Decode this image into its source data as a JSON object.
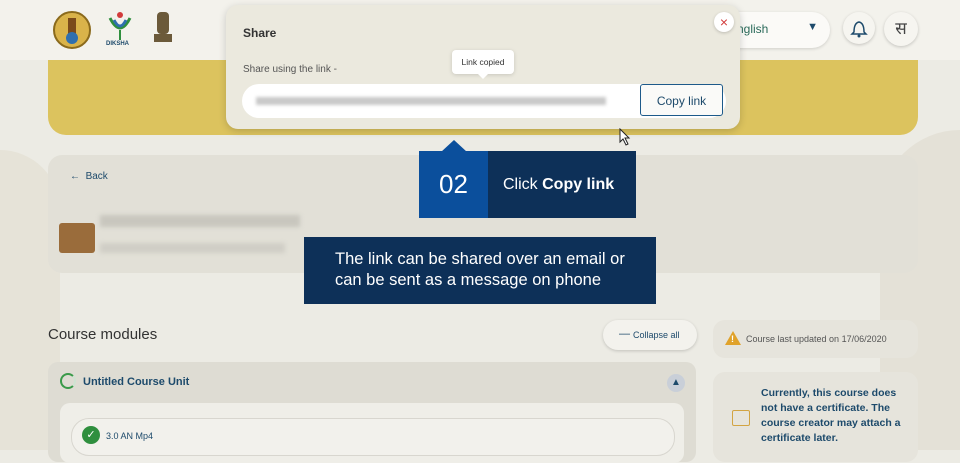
{
  "header": {
    "logo_caption": "DIKSHA",
    "language_selected": "nglish",
    "avatar_initial": "स"
  },
  "share_modal": {
    "title": "Share",
    "share_label": "Share using the link -",
    "copy_button": "Copy link",
    "tooltip": "Link copied",
    "close_symbol": "×"
  },
  "course": {
    "back_label": "Back"
  },
  "modules": {
    "heading": "Course modules",
    "collapse_label": "Collapse all",
    "unit_title": "Untitled Course Unit",
    "items": [
      {
        "label": "3.0 AN Mp4"
      }
    ]
  },
  "sidebar": {
    "last_updated": "Course last updated on 17/06/2020",
    "certificate_note": "Currently, this course does not have a certificate. The course creator may attach a certificate later."
  },
  "tutorial": {
    "step_number": "02",
    "step_prefix": "Click ",
    "step_bold": "Copy link",
    "note": "The link can be shared over an email or can be sent as a message on phone"
  },
  "colors": {
    "accent_blue": "#0b4f9c",
    "navy": "#0d3058",
    "banner_yellow": "#dcc35e",
    "success_green": "#2f8f3e"
  }
}
